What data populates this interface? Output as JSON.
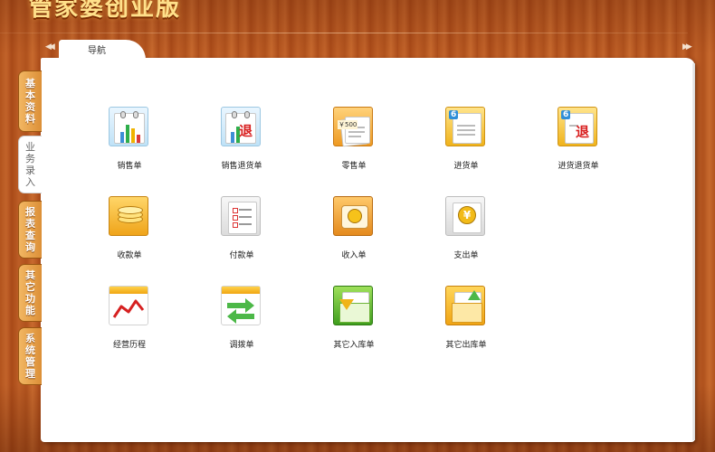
{
  "app": {
    "title": "管家婆创业版"
  },
  "nav": {
    "tab_label": "导航",
    "prev_glyph": "◀◀",
    "next_glyph": "▶▶"
  },
  "side_tabs": [
    "基本资料",
    "业务录入",
    "报表查询",
    "其它功能",
    "系统管理"
  ],
  "active_side_tab": "业务录入",
  "icon_badges": {
    "return": "退",
    "number": "6",
    "price": "￥500"
  },
  "grid": [
    [
      {
        "label": "销售单",
        "icon": "sales-chart-icon"
      },
      {
        "label": "销售退货单",
        "icon": "sales-return-icon"
      },
      {
        "label": "零售单",
        "icon": "retail-receipt-icon"
      },
      {
        "label": "进货单",
        "icon": "purchase-doc-icon"
      },
      {
        "label": "进货退货单",
        "icon": "purchase-return-icon"
      }
    ],
    [
      {
        "label": "收款单",
        "icon": "coins-icon"
      },
      {
        "label": "付款单",
        "icon": "checklist-icon"
      },
      {
        "label": "收入单",
        "icon": "money-bag-icon"
      },
      {
        "label": "支出单",
        "icon": "yen-clipboard-icon"
      }
    ],
    [
      {
        "label": "经营历程",
        "icon": "trend-chart-icon"
      },
      {
        "label": "调拨单",
        "icon": "transfer-arrows-icon"
      },
      {
        "label": "其它入库单",
        "icon": "stock-in-icon"
      },
      {
        "label": "其它出库单",
        "icon": "stock-out-icon"
      }
    ]
  ]
}
